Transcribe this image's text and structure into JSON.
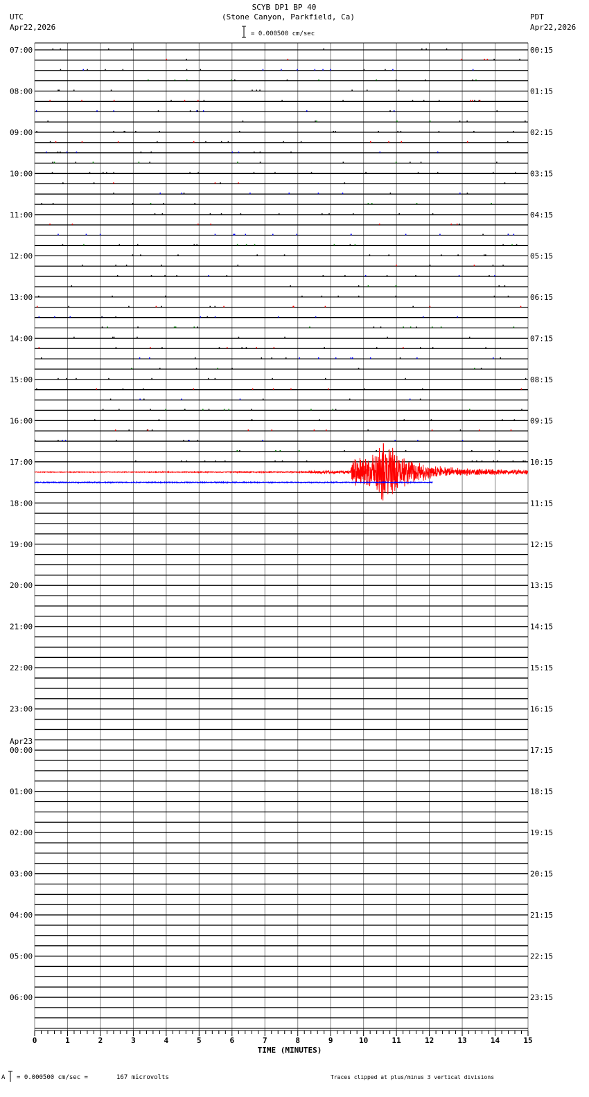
{
  "header": {
    "title": "SCYB DP1 BP 40",
    "subtitle": "(Stone Canyon, Parkfield, Ca)",
    "left_tz": "UTC",
    "left_date": "Apr22,2026",
    "right_tz": "PDT",
    "right_date": "Apr22,2026",
    "scale_text": "= 0.000500 cm/sec"
  },
  "footer": {
    "scale_text": "= 0.000500 cm/sec =",
    "microvolts": "167 microvolts",
    "clip_note": "Traces clipped at plus/minus 3 vertical divisions",
    "left_mark": "A"
  },
  "chart_data": {
    "type": "helicorder",
    "xlabel": "TIME (MINUTES)",
    "xlim": [
      0,
      15
    ],
    "xticks": [
      "0",
      "1",
      "2",
      "3",
      "4",
      "5",
      "6",
      "7",
      "8",
      "9",
      "10",
      "11",
      "12",
      "13",
      "14",
      "15"
    ],
    "minutes_per_row": 15,
    "row_count": 96,
    "trace_colors": [
      "#000000",
      "#ff0000",
      "#0000ff",
      "#008000"
    ],
    "grid_color": "#808080",
    "utc_labels": [
      "07:00",
      "08:00",
      "09:00",
      "10:00",
      "11:00",
      "12:00",
      "13:00",
      "14:00",
      "15:00",
      "16:00",
      "17:00",
      "18:00",
      "19:00",
      "20:00",
      "21:00",
      "22:00",
      "23:00",
      "00:00",
      "01:00",
      "02:00",
      "03:00",
      "04:00",
      "05:00",
      "06:00"
    ],
    "date_change_label": "Apr23",
    "pdt_labels": [
      "00:15",
      "01:15",
      "02:15",
      "03:15",
      "04:15",
      "05:15",
      "06:15",
      "07:15",
      "08:15",
      "09:15",
      "10:15",
      "11:15",
      "12:15",
      "13:15",
      "14:15",
      "15:15",
      "16:15",
      "17:15",
      "18:15",
      "19:15",
      "20:15",
      "21:15",
      "22:15",
      "23:15"
    ],
    "data_rows_with_sparse_noise": 41,
    "continuous_trace_rows": [
      {
        "row": 41,
        "start_min": 0,
        "end_min": 15,
        "color": "#ff0000",
        "label": "17:15 UTC"
      },
      {
        "row": 42,
        "start_min": 0,
        "end_min": 12.1,
        "color": "#0000ff",
        "label": "17:30 UTC"
      }
    ],
    "event": {
      "row": 41,
      "units": "vertical divisions (1 div = 0.000500 cm/sec)",
      "clip": 3,
      "envelope": [
        [
          0,
          0.03
        ],
        [
          8.3,
          0.05
        ],
        [
          8.35,
          0.15
        ],
        [
          9.6,
          0.15
        ],
        [
          9.7,
          1.5
        ],
        [
          10.0,
          1.3
        ],
        [
          10.3,
          1.6
        ],
        [
          10.5,
          2.6
        ],
        [
          10.65,
          3.0
        ],
        [
          10.9,
          2.3
        ],
        [
          11.2,
          1.4
        ],
        [
          11.6,
          0.9
        ],
        [
          12.0,
          0.6
        ],
        [
          13.0,
          0.35
        ],
        [
          14.0,
          0.25
        ],
        [
          15.0,
          0.2
        ]
      ]
    }
  }
}
